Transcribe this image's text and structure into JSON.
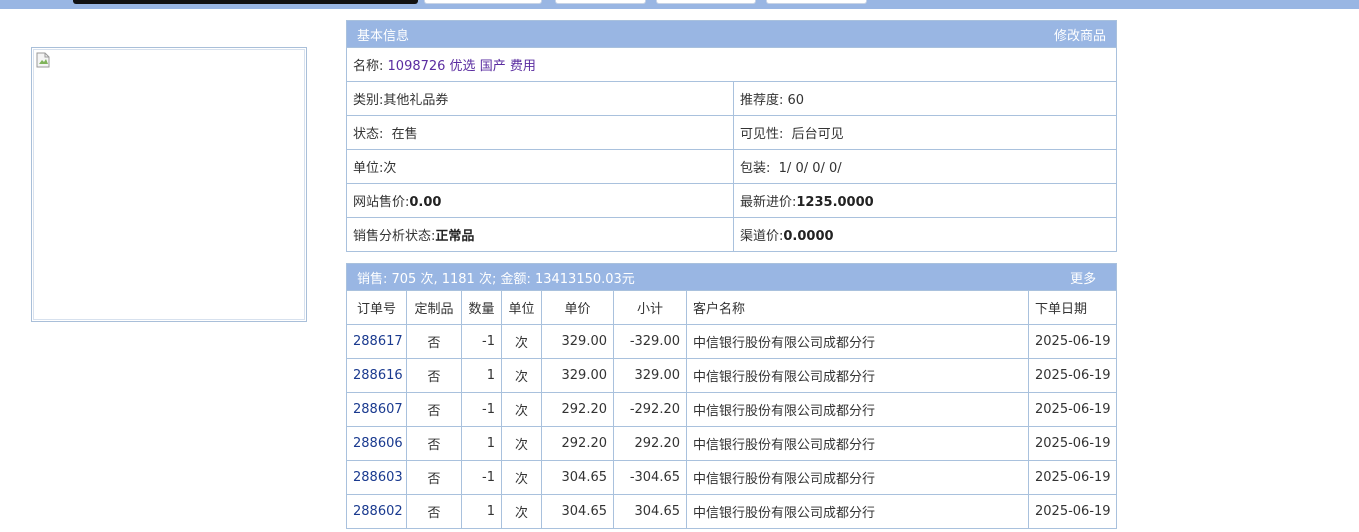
{
  "info": {
    "header": "基本信息",
    "edit_link": "修改商品",
    "name_label": "名称:",
    "name_value": "1098726 优选 国产 费用",
    "category_label": "类别:",
    "category_value": "其他礼品券",
    "recommend_label": "推荐度:",
    "recommend_value": "60",
    "status_label": "状态:",
    "status_value": "在售",
    "visibility_label": "可见性:",
    "visibility_value": "后台可见",
    "unit_label": "单位:",
    "unit_value": "次",
    "package_label": "包装:",
    "package_value": "1/ 0/ 0/ 0/",
    "web_price_label": "网站售价:",
    "web_price_value": "0.00",
    "latest_purchase_label": "最新进价:",
    "latest_purchase_value": "1235.0000",
    "sales_status_label": "销售分析状态:",
    "sales_status_value": "正常品",
    "channel_price_label": "渠道价:",
    "channel_price_value": "0.0000"
  },
  "sales": {
    "summary": "销售:  705 次, 1181 次; 金额: 13413150.03元",
    "more_link": "更多",
    "columns": [
      "订单号",
      "定制品",
      "数量",
      "单位",
      "单价",
      "小计",
      "客户名称",
      "下单日期"
    ],
    "rows": [
      [
        "288617",
        "否",
        "-1",
        "次",
        "329.00",
        "-329.00",
        "中信银行股份有限公司成都分行",
        "2025-06-19"
      ],
      [
        "288616",
        "否",
        "1",
        "次",
        "329.00",
        "329.00",
        "中信银行股份有限公司成都分行",
        "2025-06-19"
      ],
      [
        "288607",
        "否",
        "-1",
        "次",
        "292.20",
        "-292.20",
        "中信银行股份有限公司成都分行",
        "2025-06-19"
      ],
      [
        "288606",
        "否",
        "1",
        "次",
        "292.20",
        "292.20",
        "中信银行股份有限公司成都分行",
        "2025-06-19"
      ],
      [
        "288603",
        "否",
        "-1",
        "次",
        "304.65",
        "-304.65",
        "中信银行股份有限公司成都分行",
        "2025-06-19"
      ],
      [
        "288602",
        "否",
        "1",
        "次",
        "304.65",
        "304.65",
        "中信银行股份有限公司成都分行",
        "2025-06-19"
      ]
    ]
  },
  "colors": {
    "header_bg": "#99b6e3",
    "border": "#a9c1dd",
    "link": "#1a3a8f"
  }
}
